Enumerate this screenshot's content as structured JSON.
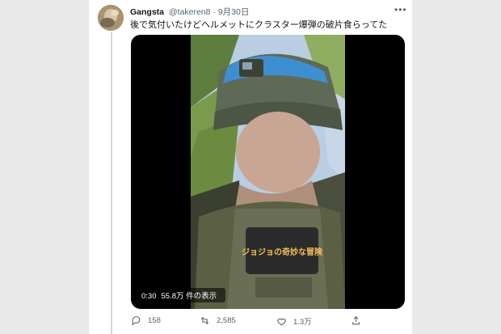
{
  "tweet": {
    "author_name": "Gangsta",
    "handle": "@takeren8",
    "separator": "·",
    "date": "9月30日",
    "more_icon": "more-horizontal-icon",
    "text": "後で気付いたけどヘルメットにクラスター爆弾の破片食らってた"
  },
  "media": {
    "duration": "0:30",
    "views": "55.8万 件の表示",
    "patch_text": "ジョジョの奇妙な冒険"
  },
  "actions": {
    "reply_count": "158",
    "retweet_count": "2,585",
    "like_count": "1.3万",
    "share_label": ""
  },
  "colors": {
    "text": "#0f1419",
    "secondary": "#536471",
    "thread_line": "#cfd9de",
    "background": "#e9e9e9"
  }
}
